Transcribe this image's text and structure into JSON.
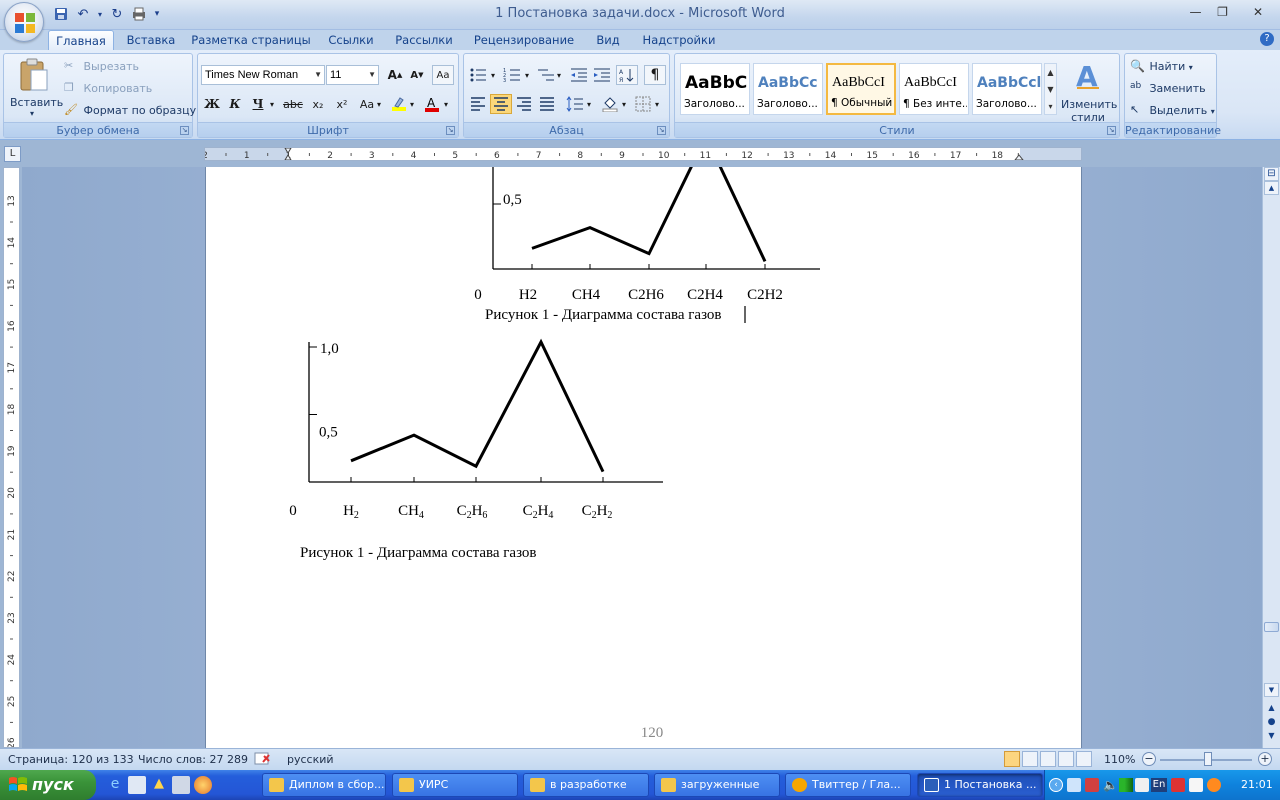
{
  "window": {
    "title": "1 Постановка задачи.docx - Microsoft Word"
  },
  "tabs": [
    "Главная",
    "Вставка",
    "Разметка страницы",
    "Ссылки",
    "Рассылки",
    "Рецензирование",
    "Вид",
    "Надстройки"
  ],
  "ribbon": {
    "clipboard": {
      "label": "Буфер обмена",
      "paste": "Вставить",
      "cut": "Вырезать",
      "copy": "Копировать",
      "format_painter": "Формат по образцу"
    },
    "font": {
      "label": "Шрифт",
      "font_name": "Times New Roman",
      "font_size": "11",
      "bold": "Ж",
      "italic": "К",
      "underline": "Ч",
      "strike": "abc",
      "subscript": "x₂",
      "superscript": "x²",
      "change_case": "Aa"
    },
    "paragraph": {
      "label": "Абзац"
    },
    "styles": {
      "label": "Стили",
      "items": [
        {
          "sample": "AaBbC",
          "name": "Заголово...",
          "color": "#000000"
        },
        {
          "sample": "AaBbCc",
          "name": "Заголово...",
          "color": "#4f81bd"
        },
        {
          "sample": "AaBbCcI",
          "name": "¶ Обычный",
          "color": "#000000"
        },
        {
          "sample": "AaBbCcI",
          "name": "¶ Без инте...",
          "color": "#000000"
        },
        {
          "sample": "AaBbCcl",
          "name": "Заголово...",
          "color": "#4f81bd"
        }
      ],
      "change_styles": "Изменить стили"
    },
    "editing": {
      "label": "Редактирование",
      "find": "Найти",
      "replace": "Заменить",
      "select": "Выделить"
    }
  },
  "ruler": {
    "h_labels": [
      "2",
      "1",
      "1",
      "2",
      "3",
      "4",
      "5",
      "6",
      "7",
      "8",
      "9",
      "10",
      "11",
      "12",
      "13",
      "14",
      "15",
      "16",
      "17",
      "18"
    ],
    "v_labels": [
      "13",
      "14",
      "15",
      "16",
      "17",
      "18",
      "19",
      "20",
      "21",
      "22",
      "23",
      "24",
      "25",
      "26"
    ]
  },
  "chart_data": [
    {
      "type": "line",
      "title": "",
      "categories": [
        "H2",
        "CH4",
        "C2H6",
        "C2H4",
        "C2H2"
      ],
      "values": [
        0.12,
        0.28,
        0.08,
        0.98,
        0.02
      ],
      "y_ticks": [
        "0,5"
      ],
      "origin_label": "0",
      "caption": "Рисунок 1 - Диаграмма состава газов"
    },
    {
      "type": "line",
      "title": "",
      "categories": [
        "H2",
        "CH4",
        "C2H6",
        "C2H4",
        "C2H2"
      ],
      "values": [
        0.12,
        0.31,
        0.08,
        1.0,
        0.04
      ],
      "y_ticks": [
        "0,5",
        "1,0"
      ],
      "origin_label": "0",
      "caption": "Рисунок 1 - Диаграмма состава газов"
    }
  ],
  "page_number": "120",
  "statusbar": {
    "page": "Страница: 120 из 133",
    "words": "Число слов: 27 289",
    "language": "русский",
    "zoom": "110%"
  },
  "taskbar": {
    "start": "пуск",
    "buttons": [
      {
        "label": "Диплом в сбор...",
        "icon_color": "#f3c64b"
      },
      {
        "label": "УИРС",
        "icon_color": "#f3c64b"
      },
      {
        "label": "в разработке",
        "icon_color": "#f3c64b"
      },
      {
        "label": "загруженные",
        "icon_color": "#f3c64b"
      },
      {
        "label": "Твиттер / Гла...",
        "icon_color": "#f6a600"
      },
      {
        "label": "1 Постановка ...",
        "icon_color": "#2b5fba"
      }
    ],
    "lang": "EN",
    "kbd": "En",
    "clock": "21:01"
  }
}
